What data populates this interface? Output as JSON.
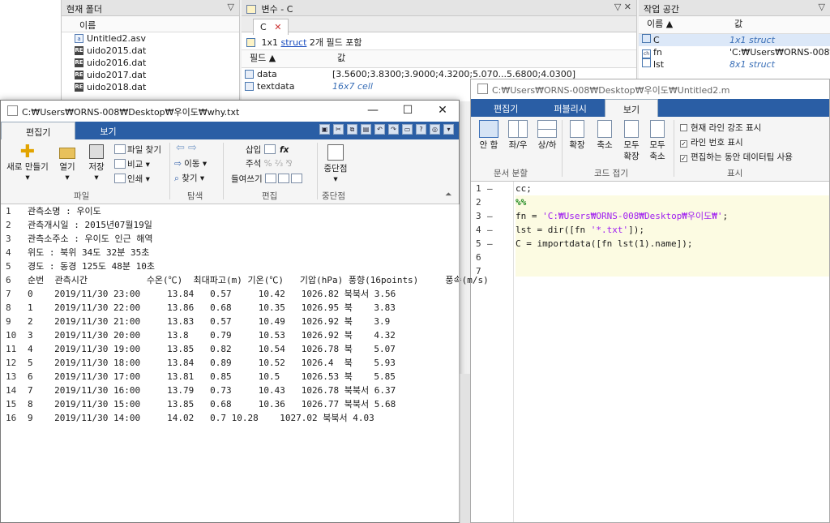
{
  "folder": {
    "title": "현재 폴더",
    "col_name": "이름",
    "files": [
      {
        "name": "Untitled2.asv",
        "icon": "asv-file-icon"
      },
      {
        "name": "uido2015.dat",
        "icon": "dat-file-icon"
      },
      {
        "name": "uido2016.dat",
        "icon": "dat-file-icon"
      },
      {
        "name": "uido2017.dat",
        "icon": "dat-file-icon"
      },
      {
        "name": "uido2018.dat",
        "icon": "dat-file-icon"
      }
    ]
  },
  "variables": {
    "title": "변수 - C",
    "tab": "C",
    "struct_prefix": "1x1",
    "struct_link": "struct",
    "struct_suffix": "2개 필드 포함",
    "col_field": "필드",
    "col_value": "값",
    "rows": [
      {
        "field": "data",
        "value": "[3.5600;3.8300;3.9000;4.3200;5.070...5.6800;4.0300]"
      },
      {
        "field": "textdata",
        "value": "16x7 cell"
      }
    ]
  },
  "workspace": {
    "title": "작업 공간",
    "col_name": "이름",
    "col_value": "값",
    "rows": [
      {
        "name": "C",
        "value": "1x1 struct"
      },
      {
        "name": "fn",
        "value": "'C:₩Users₩ORNS-008₩..."
      },
      {
        "name": "lst",
        "value": "8x1 struct"
      }
    ]
  },
  "editor2": {
    "title": "C:₩Users₩ORNS-008₩Desktop₩우이도₩Untitled2.m",
    "tabs": [
      "편집기",
      "퍼블리시",
      "보기"
    ],
    "active_tab": "보기",
    "buttons": {
      "single": "안 함",
      "lr": "좌/우",
      "tb": "상/하",
      "expand": "확장",
      "collapse": "축소",
      "expand_all_1": "모두",
      "expand_all_2": "확장",
      "collapse_all_1": "모두",
      "collapse_all_2": "축소"
    },
    "group_split": "문서 분할",
    "group_fold": "코드 접기",
    "group_show": "표시",
    "checkboxes": [
      "현재 라인 강조 표시",
      "라인 번호 표시",
      "편집하는 동안 데이터팁 사용"
    ],
    "code_lines": [
      {
        "n": "1",
        "dash": "—",
        "text": "cc;"
      },
      {
        "n": "2",
        "dash": "",
        "text": "%%"
      },
      {
        "n": "3",
        "dash": "—",
        "pre": "fn = ",
        "str": "'C:₩Users₩ORNS-008₩Desktop₩우이도₩'",
        "post": ";"
      },
      {
        "n": "4",
        "dash": "—",
        "pre": "lst = dir([fn ",
        "str": "'*.txt'",
        "post": "]);"
      },
      {
        "n": "5",
        "dash": "—",
        "text": "C = importdata([fn lst(1).name]);"
      },
      {
        "n": "6",
        "dash": "",
        "text": ""
      },
      {
        "n": "7",
        "dash": "",
        "text": ""
      }
    ]
  },
  "notepad": {
    "title": "C:₩Users₩ORNS-008₩Desktop₩우이도₩why.txt",
    "tabs": [
      "편집기",
      "보기"
    ],
    "active_tab": "편집기",
    "buttons": {
      "new": "새로 만들기",
      "open": "열기",
      "save": "저장",
      "find_files": "파일 찾기",
      "compare": "비교",
      "print": "인쇄",
      "goto": "이동",
      "find": "찾기",
      "insert": "삽입",
      "comment": "주석",
      "indent": "들여쓰기",
      "breakpoints": "중단점"
    },
    "groups": [
      "파일",
      "탐색",
      "편집",
      "중단점"
    ],
    "lines": [
      {
        "n": "1",
        "t": "관측소명 : 우이도"
      },
      {
        "n": "2",
        "t": "관측개시일 : 2015년07월19일"
      },
      {
        "n": "3",
        "t": "관측소주소 : 우이도 인근 해역"
      },
      {
        "n": "4",
        "t": "위도 : 북위 34도 32분 35초"
      },
      {
        "n": "5",
        "t": "경도 : 동경 125도 48분 10초"
      },
      {
        "n": "6",
        "t": "순번  관측시간           수온(℃)  최대파고(m) 기온(℃)   기압(hPa) 풍향(16points)     풍속(m/s)"
      },
      {
        "n": "7",
        "t": "0    2019/11/30 23:00     13.84   0.57     10.42   1026.82 북북서 3.56"
      },
      {
        "n": "8",
        "t": "1    2019/11/30 22:00     13.86   0.68     10.35   1026.95 북    3.83"
      },
      {
        "n": "9",
        "t": "2    2019/11/30 21:00     13.83   0.57     10.49   1026.92 북    3.9"
      },
      {
        "n": "10",
        "t": "3    2019/11/30 20:00     13.8    0.79     10.53   1026.92 북    4.32"
      },
      {
        "n": "11",
        "t": "4    2019/11/30 19:00     13.85   0.82     10.54   1026.78 북    5.07"
      },
      {
        "n": "12",
        "t": "5    2019/11/30 18:00     13.84   0.89     10.52   1026.4  북    5.93"
      },
      {
        "n": "13",
        "t": "6    2019/11/30 17:00     13.81   0.85     10.5    1026.53 북    5.85"
      },
      {
        "n": "14",
        "t": "7    2019/11/30 16:00     13.79   0.73     10.43   1026.78 북북서 6.37"
      },
      {
        "n": "15",
        "t": "8    2019/11/30 15:00     13.85   0.68     10.36   1026.77 북북서 5.68"
      },
      {
        "n": "16",
        "t": "9    2019/11/30 14:00     14.02   0.7 10.28    1027.02 북북서 4.03"
      }
    ]
  }
}
